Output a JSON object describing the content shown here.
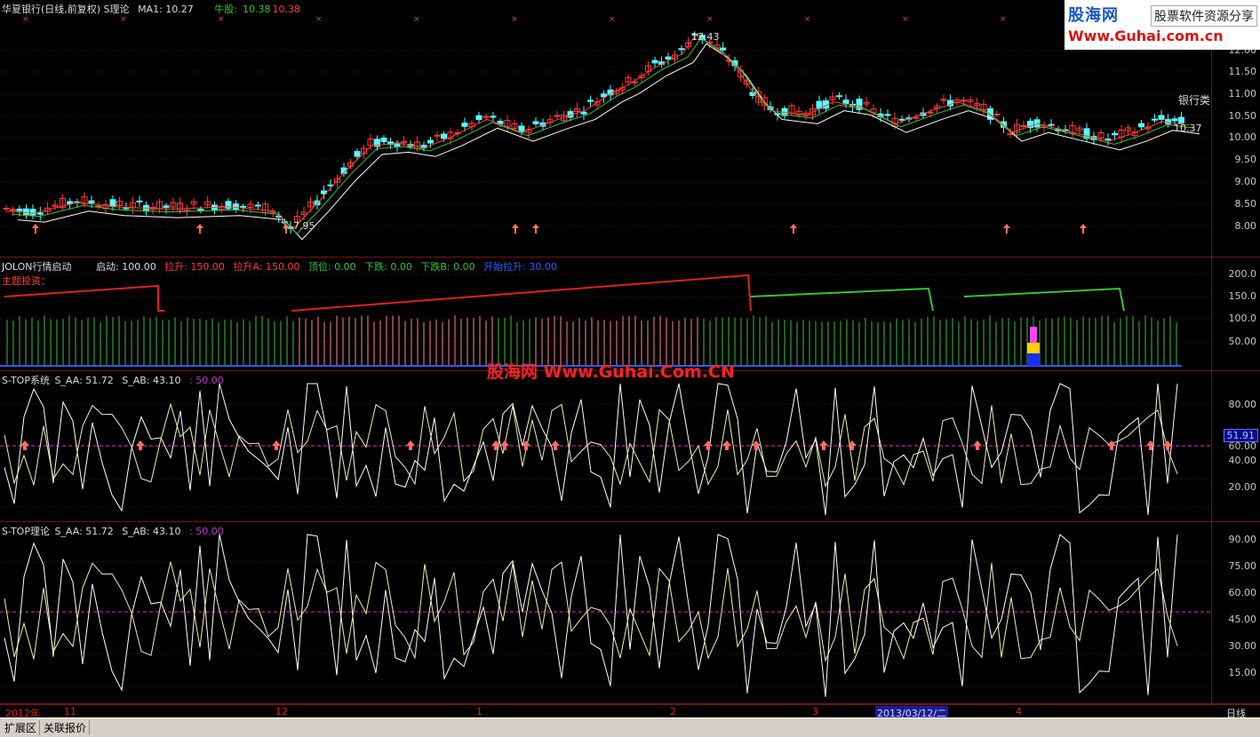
{
  "main": {
    "title": "华夏银行(日线,前复权) S理论",
    "ma1": "MA1: 10.27",
    "bull_label": "牛股:",
    "bull_val1": "10.38",
    "bull_val2": "10.38",
    "high_label": "12.43",
    "low_label": "7.95",
    "last_price": "10.37",
    "sector": "银行类",
    "ticks": [
      "12.00",
      "11.50",
      "11.00",
      "10.50",
      "10.00",
      "9.50",
      "9.00",
      "8.50",
      "8.00"
    ]
  },
  "logo": {
    "brand": "股海网",
    "tagline": "股票软件资源分享",
    "url": "Www.Guhai.com.cn"
  },
  "jolon": {
    "title": "JOLON行情启动",
    "subtitle": "主题投资：",
    "qidong": "启动: 100.00",
    "lasheng": "拉升: 150.00",
    "lashengA": "拉升A: 150.00",
    "dingwei": "顶位: 0.00",
    "xiadie": "下跌: 0.00",
    "xiadieB": "下跌B: 0.00",
    "kaishi": "开始拉升: 30.00",
    "ticks": [
      "200.0",
      "150.0",
      "100.0",
      "50.00"
    ]
  },
  "watermark": "股海网 Www.Guhai.Com.CN",
  "stop1": {
    "title": "S-TOP系统",
    "aa": "S_AA: 51.72",
    "ab": "S_AB: 43.10",
    "ref": ": 50.00",
    "current": "51.91",
    "ticks": [
      "80.00",
      "60.00",
      "40.00",
      "20.00"
    ]
  },
  "stop2": {
    "title": "S-TOP理论",
    "aa": "S_AA: 51.72",
    "ab": "S_AB: 43.10",
    "ref": ": 50.00",
    "ticks": [
      "90.00",
      "75.00",
      "60.00",
      "45.00",
      "30.00",
      "15.00"
    ]
  },
  "xaxis": {
    "labels": [
      "2012年",
      "11",
      "12",
      "1",
      "2",
      "3",
      "2013/03/12/二",
      "4"
    ],
    "period": "日线"
  },
  "statusbar": {
    "tab1": "扩展区",
    "tab2": "关联报价"
  },
  "colors": {
    "up": "#ff3b3b",
    "down": "#54ffff",
    "ma_white": "#ffffff",
    "ma_red": "#ff3b3b",
    "ma_green": "#39c239",
    "dash": "#c23cc2"
  }
}
